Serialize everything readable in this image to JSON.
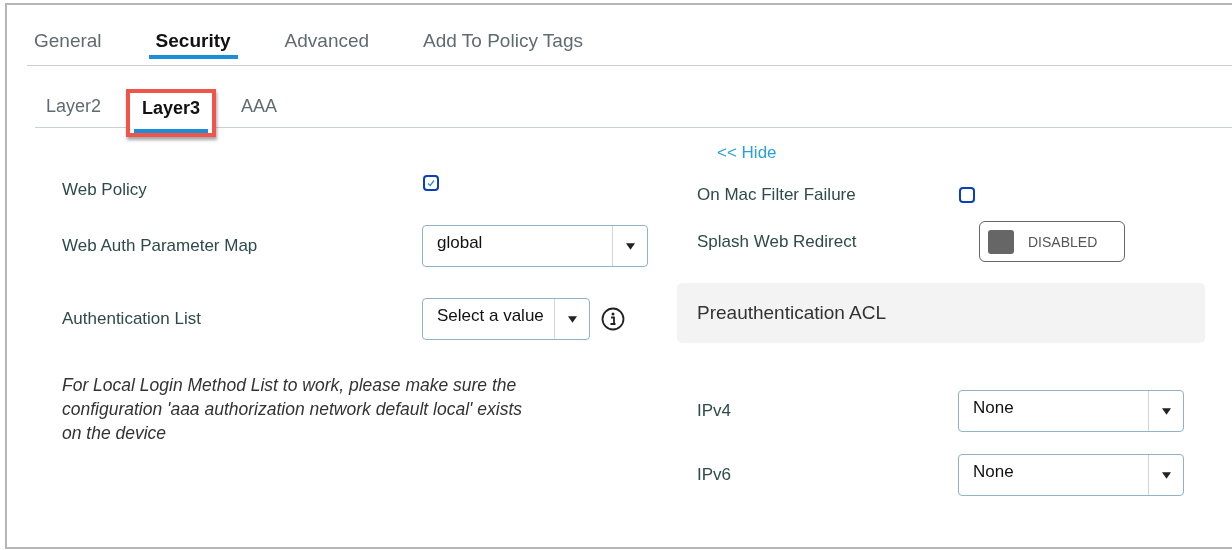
{
  "tabs": [
    {
      "label": "General",
      "selected": false
    },
    {
      "label": "Security",
      "selected": true
    },
    {
      "label": "Advanced",
      "selected": false
    },
    {
      "label": "Add To Policy Tags",
      "selected": false
    }
  ],
  "subtabs": [
    {
      "label": "Layer2",
      "selected": false,
      "highlighted": false
    },
    {
      "label": "Layer3",
      "selected": true,
      "highlighted": true
    },
    {
      "label": "AAA",
      "selected": false,
      "highlighted": false
    }
  ],
  "left": [
    {
      "kind": "checkbox",
      "label": "Web Policy",
      "checked": true
    },
    {
      "kind": "select",
      "label": "Web Auth Parameter Map",
      "value": "global"
    },
    {
      "kind": "select",
      "label": "Authentication List",
      "value": "Select a value",
      "info": true
    },
    {
      "kind": "note",
      "text": "For Local Login Method List to work, please make sure the configuration 'aaa authorization network default local' exists on the device"
    }
  ],
  "right": [
    {
      "kind": "link",
      "label": "<< Hide"
    },
    {
      "kind": "checkbox",
      "label": "On Mac Filter Failure",
      "checked": false
    },
    {
      "kind": "toggle",
      "label": "Splash Web Redirect",
      "on": false,
      "state_text": "DISABLED"
    },
    {
      "kind": "section",
      "label": "Preauthentication ACL"
    },
    {
      "kind": "select",
      "label": "IPv4",
      "value": "None"
    },
    {
      "kind": "select",
      "label": "IPv6",
      "value": "None"
    }
  ]
}
